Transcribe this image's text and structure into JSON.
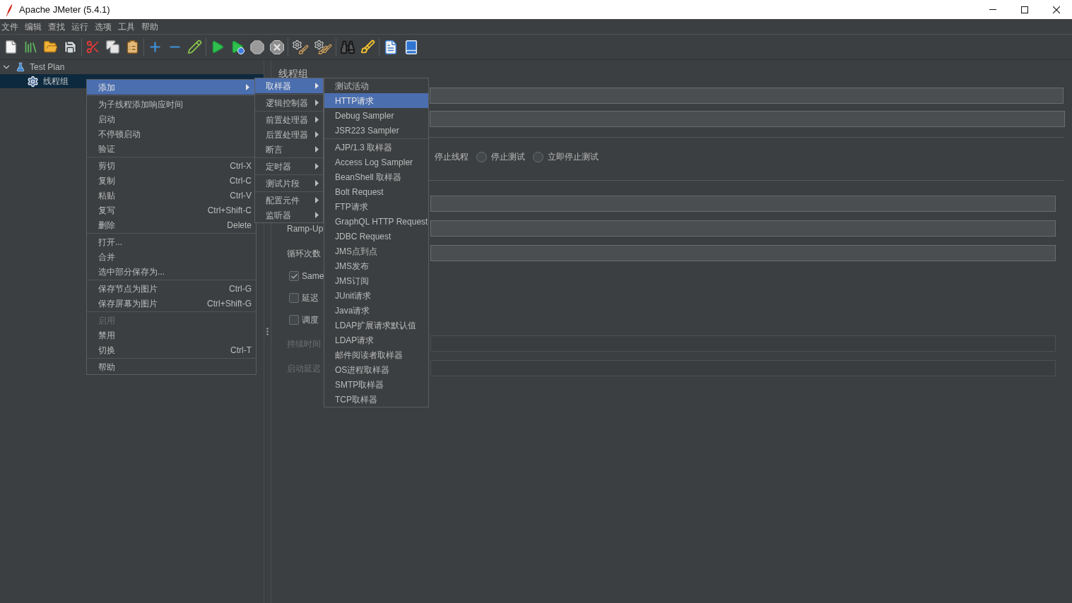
{
  "window": {
    "title": "Apache JMeter (5.4.1)"
  },
  "menu_bar": [
    "文件",
    "编辑",
    "查找",
    "运行",
    "选项",
    "工具",
    "帮助"
  ],
  "tree": [
    {
      "kind": "test_plan",
      "label": "Test Plan",
      "expanded": true,
      "selected": false,
      "children": [
        {
          "kind": "thread_group",
          "label": "线程组",
          "selected": true
        }
      ]
    }
  ],
  "editor": {
    "title": "线程组",
    "covered_option_label": "停止线程",
    "radio_options": [
      {
        "label": "停止测试",
        "selected": false
      },
      {
        "label": "立即停止测试",
        "selected": false
      }
    ],
    "rows": [
      {
        "kind": "field",
        "disabled": false
      },
      {
        "kind": "field",
        "label": "Ramp-Up",
        "disabled": false
      },
      {
        "kind": "field",
        "label": "循环次数",
        "disabled": false
      },
      {
        "kind": "checkbox",
        "label": "Same",
        "checked": true
      },
      {
        "kind": "checkbox",
        "label": "延迟",
        "checked": false
      },
      {
        "kind": "checkbox",
        "label": "调度",
        "checked": false
      },
      {
        "kind": "field",
        "label": "持续时间",
        "disabled": true
      },
      {
        "kind": "field",
        "label": "启动延迟",
        "disabled": true
      }
    ]
  },
  "context_menu": {
    "groups": [
      [
        {
          "kind": "submenu",
          "label": "添加",
          "selected": true,
          "disabled": false
        }
      ],
      [
        {
          "kind": "action",
          "label": "为子线程添加响应时间",
          "selected": false,
          "disabled": false
        },
        {
          "kind": "action",
          "label": "启动",
          "selected": false,
          "disabled": false
        },
        {
          "kind": "action",
          "label": "不停顿启动",
          "selected": false,
          "disabled": false
        },
        {
          "kind": "action",
          "label": "验证",
          "selected": false,
          "disabled": false
        }
      ],
      [
        {
          "kind": "action",
          "label": "剪切",
          "shortcut": "Ctrl-X",
          "selected": false,
          "disabled": false
        },
        {
          "kind": "action",
          "label": "复制",
          "shortcut": "Ctrl-C",
          "selected": false,
          "disabled": false
        },
        {
          "kind": "action",
          "label": "粘贴",
          "shortcut": "Ctrl-V",
          "selected": false,
          "disabled": false
        },
        {
          "kind": "action",
          "label": "复写",
          "shortcut": "Ctrl+Shift-C",
          "selected": false,
          "disabled": false
        },
        {
          "kind": "action",
          "label": "删除",
          "shortcut": "Delete",
          "selected": false,
          "disabled": false
        }
      ],
      [
        {
          "kind": "action",
          "label": "打开...",
          "selected": false,
          "disabled": false
        },
        {
          "kind": "action",
          "label": "合并",
          "selected": false,
          "disabled": false
        },
        {
          "kind": "action",
          "label": "选中部分保存为...",
          "selected": false,
          "disabled": false
        }
      ],
      [
        {
          "kind": "action",
          "label": "保存节点为图片",
          "shortcut": "Ctrl-G",
          "selected": false,
          "disabled": false
        },
        {
          "kind": "action",
          "label": "保存屏幕为图片",
          "shortcut": "Ctrl+Shift-G",
          "selected": false,
          "disabled": false
        }
      ],
      [
        {
          "kind": "action",
          "label": "启用",
          "selected": false,
          "disabled": true
        },
        {
          "kind": "action",
          "label": "禁用",
          "selected": false,
          "disabled": false
        },
        {
          "kind": "action",
          "label": "切换",
          "shortcut": "Ctrl-T",
          "selected": false,
          "disabled": false
        }
      ],
      [
        {
          "kind": "action",
          "label": "帮助",
          "selected": false,
          "disabled": false
        }
      ]
    ]
  },
  "add_submenu": {
    "groups": [
      [
        {
          "kind": "submenu",
          "label": "取样器",
          "selected": true
        }
      ],
      [
        {
          "kind": "submenu",
          "label": "逻辑控制器",
          "selected": false
        }
      ],
      [
        {
          "kind": "submenu",
          "label": "前置处理器",
          "selected": false
        },
        {
          "kind": "submenu",
          "label": "后置处理器",
          "selected": false
        },
        {
          "kind": "submenu",
          "label": "断言",
          "selected": false
        }
      ],
      [
        {
          "kind": "submenu",
          "label": "定时器",
          "selected": false
        }
      ],
      [
        {
          "kind": "submenu",
          "label": "测试片段",
          "selected": false
        }
      ],
      [
        {
          "kind": "submenu",
          "label": "配置元件",
          "selected": false
        },
        {
          "kind": "submenu",
          "label": "监听器",
          "selected": false
        }
      ]
    ]
  },
  "sampler_submenu": {
    "groups": [
      [
        {
          "kind": "action",
          "label": "测试活动",
          "selected": false
        },
        {
          "kind": "action",
          "label": "HTTP请求",
          "selected": true
        },
        {
          "kind": "action",
          "label": "Debug Sampler",
          "selected": false
        },
        {
          "kind": "action",
          "label": "JSR223 Sampler",
          "selected": false
        }
      ],
      [
        {
          "kind": "action",
          "label": "AJP/1.3 取样器",
          "selected": false
        },
        {
          "kind": "action",
          "label": "Access Log Sampler",
          "selected": false
        },
        {
          "kind": "action",
          "label": "BeanShell 取样器",
          "selected": false
        },
        {
          "kind": "action",
          "label": "Bolt Request",
          "selected": false
        },
        {
          "kind": "action",
          "label": "FTP请求",
          "selected": false
        },
        {
          "kind": "action",
          "label": "GraphQL HTTP Request",
          "selected": false
        },
        {
          "kind": "action",
          "label": "JDBC Request",
          "selected": false
        },
        {
          "kind": "action",
          "label": "JMS点到点",
          "selected": false
        },
        {
          "kind": "action",
          "label": "JMS发布",
          "selected": false
        },
        {
          "kind": "action",
          "label": "JMS订阅",
          "selected": false
        },
        {
          "kind": "action",
          "label": "JUnit请求",
          "selected": false
        },
        {
          "kind": "action",
          "label": "Java请求",
          "selected": false
        },
        {
          "kind": "action",
          "label": "LDAP扩展请求默认值",
          "selected": false
        },
        {
          "kind": "action",
          "label": "LDAP请求",
          "selected": false
        },
        {
          "kind": "action",
          "label": "邮件阅读者取样器",
          "selected": false
        },
        {
          "kind": "action",
          "label": "OS进程取样器",
          "selected": false
        },
        {
          "kind": "action",
          "label": "SMTP取样器",
          "selected": false
        },
        {
          "kind": "action",
          "label": "TCP取样器",
          "selected": false
        }
      ]
    ]
  }
}
